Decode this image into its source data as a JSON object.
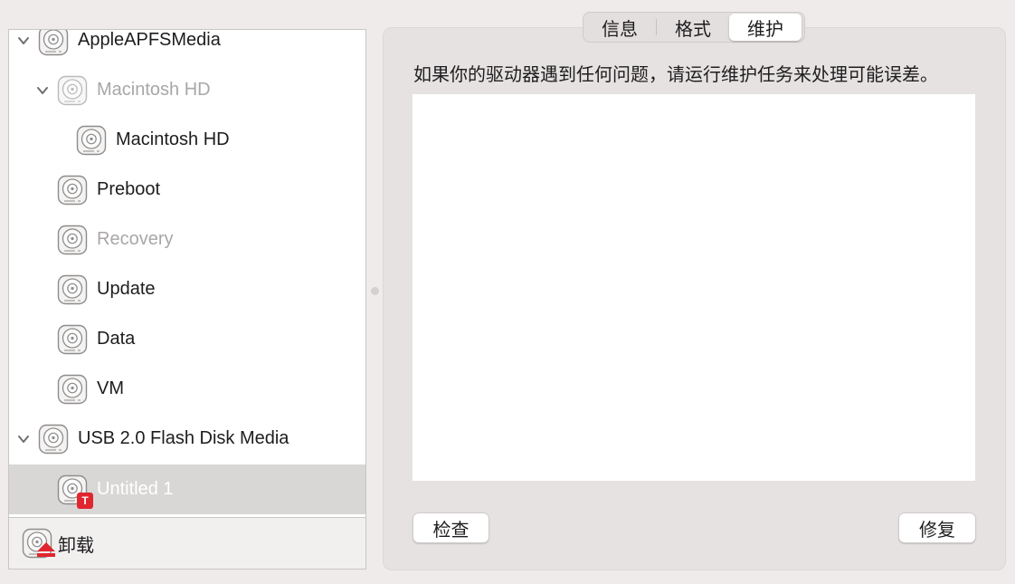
{
  "sidebar": {
    "items": [
      {
        "label": "AppleAPFSMedia",
        "icon": "disk-icon",
        "expanded": true
      },
      {
        "label": "Macintosh HD",
        "icon": "disk-icon",
        "expanded": true,
        "dim": true
      },
      {
        "label": "Macintosh HD",
        "icon": "disk-icon"
      },
      {
        "label": "Preboot",
        "icon": "disk-icon"
      },
      {
        "label": "Recovery",
        "icon": "disk-icon",
        "dim": true
      },
      {
        "label": "Update",
        "icon": "disk-icon"
      },
      {
        "label": "Data",
        "icon": "disk-icon"
      },
      {
        "label": "VM",
        "icon": "disk-icon"
      },
      {
        "label": "USB 2.0 Flash Disk Media",
        "icon": "disk-icon",
        "expanded": true
      },
      {
        "label": "Untitled 1",
        "icon": "disk-icon",
        "badge": "T",
        "selected": true
      }
    ],
    "unmount_label": "卸载"
  },
  "tabs": [
    "信息",
    "格式",
    "维护"
  ],
  "active_tab": "维护",
  "main": {
    "hint": "如果你的驱动器遇到任何问题，请运行维护任务来处理可能误差。",
    "check_label": "检查",
    "repair_label": "修复"
  },
  "colors": {
    "badge": "#e0262f",
    "eject": "#e0262f",
    "selected_row": "#d9d7d6",
    "window_bg": "#efebea"
  }
}
